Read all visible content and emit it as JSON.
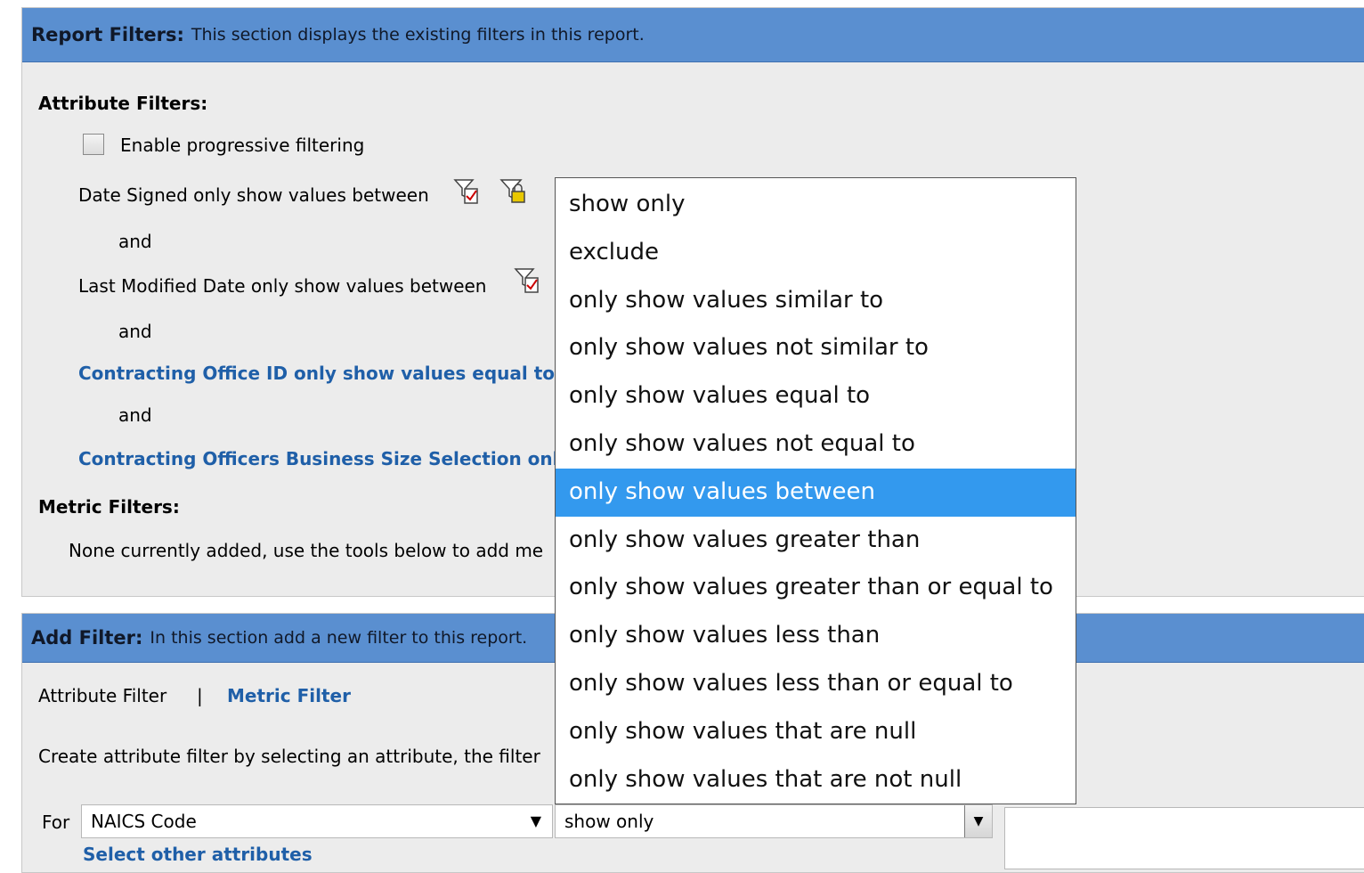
{
  "report_filters": {
    "header_title": "Report Filters:",
    "header_desc": "This section displays the existing filters in this report.",
    "attribute_filters_label": "Attribute Filters:",
    "progressive_label": "Enable progressive filtering",
    "filters": [
      {
        "text": "Date Signed only show values between"
      },
      {
        "text": "Last Modified Date only show values between"
      },
      {
        "text": "Contracting Office ID only show values equal to \""
      },
      {
        "text": "Contracting Officers Business Size Selection only"
      }
    ],
    "and_label": "and",
    "metric_filters_label": "Metric Filters:",
    "metric_none_text": "None currently added, use the tools below to add me"
  },
  "add_filter": {
    "header_title": "Add Filter:",
    "header_desc": "In this section add a new filter to this report.",
    "tab_attribute": "Attribute Filter",
    "tab_separator": "|",
    "tab_metric": "Metric Filter",
    "instruction": "Create attribute filter by selecting an attribute, the filter",
    "for_label": "For",
    "attribute_value": "NAICS Code",
    "operator_value": "show only",
    "select_other": "Select other attributes"
  },
  "dropdown": {
    "options": [
      "show only",
      "exclude",
      "only show values similar to",
      "only show values not similar to",
      "only show values equal to",
      "only show values not equal to",
      "only show values between",
      "only show values greater than",
      "only show values greater than or equal to",
      "only show values less than",
      "only show values less than or equal to",
      "only show values that are null",
      "only show values that are not null"
    ],
    "selected_index": 6
  },
  "colors": {
    "header_bg": "#5a8fd0",
    "panel_bg": "#ececec",
    "link": "#1f5fa8",
    "selected_option": "#3399ee"
  },
  "icons": [
    "filter-edit-icon",
    "filter-lock-icon"
  ]
}
